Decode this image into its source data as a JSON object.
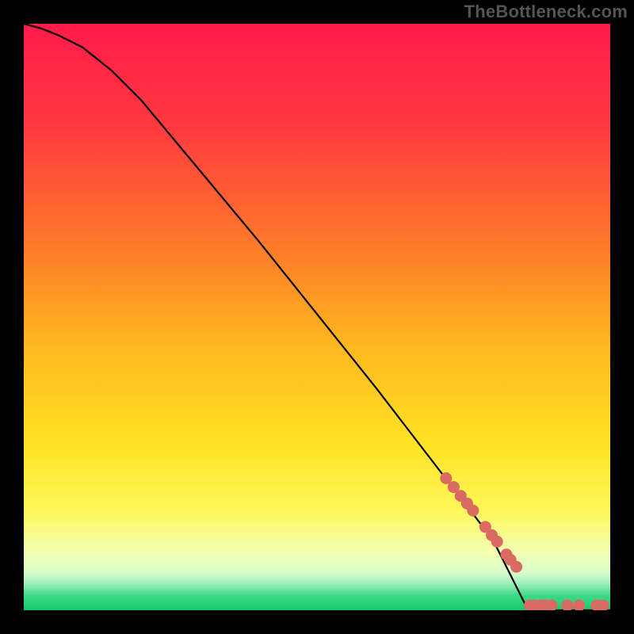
{
  "watermark": "TheBottleneck.com",
  "chart_data": {
    "type": "line",
    "title": "",
    "xlabel": "",
    "ylabel": "",
    "xlim": [
      0,
      100
    ],
    "ylim": [
      0,
      100
    ],
    "grid": false,
    "curve_comment": "Black curve: starts at top-left (0,100), slight convex near start, then near-linear down to roughly (86,0), then flat along bottom to (100,0). Values approximate percentages on both axes.",
    "series": [
      {
        "name": "curve",
        "type": "line",
        "x": [
          0,
          3,
          6,
          10,
          15,
          20,
          30,
          40,
          50,
          60,
          70,
          80,
          86,
          90,
          95,
          100
        ],
        "values": [
          100,
          99.2,
          98,
          96,
          92,
          87,
          75,
          63,
          50.5,
          38,
          25,
          12,
          0,
          0,
          0,
          0
        ]
      },
      {
        "name": "points-on-slope",
        "type": "scatter",
        "color": "#db6a63",
        "x": [
          72,
          73.3,
          74.5,
          75.6,
          76.6,
          78.7,
          79.8,
          80.7,
          82.3,
          83.0,
          84.0
        ],
        "values": [
          22.5,
          21.0,
          19.5,
          18.2,
          17.0,
          14.2,
          12.8,
          11.7,
          9.5,
          8.6,
          7.4
        ]
      },
      {
        "name": "points-on-floor",
        "type": "scatter",
        "color": "#db6a63",
        "x": [
          86.3,
          87.1,
          88.2,
          89.0,
          90.0,
          92.7,
          94.7,
          97.7,
          98.8
        ],
        "values": [
          0,
          0,
          0,
          0,
          0,
          0,
          0,
          0,
          0
        ]
      }
    ],
    "background_gradient": {
      "type": "vertical",
      "stops": [
        {
          "offset": 0.0,
          "color": "#ff1a4b"
        },
        {
          "offset": 0.18,
          "color": "#ff3b3f"
        },
        {
          "offset": 0.38,
          "color": "#ff7a2a"
        },
        {
          "offset": 0.55,
          "color": "#ffb81e"
        },
        {
          "offset": 0.72,
          "color": "#ffe324"
        },
        {
          "offset": 0.83,
          "color": "#fff75a"
        },
        {
          "offset": 0.9,
          "color": "#f4ffb0"
        },
        {
          "offset": 0.935,
          "color": "#d9ffcc"
        },
        {
          "offset": 0.955,
          "color": "#9ef0b8"
        },
        {
          "offset": 0.975,
          "color": "#3fd887"
        },
        {
          "offset": 1.0,
          "color": "#17c96f"
        }
      ]
    }
  }
}
